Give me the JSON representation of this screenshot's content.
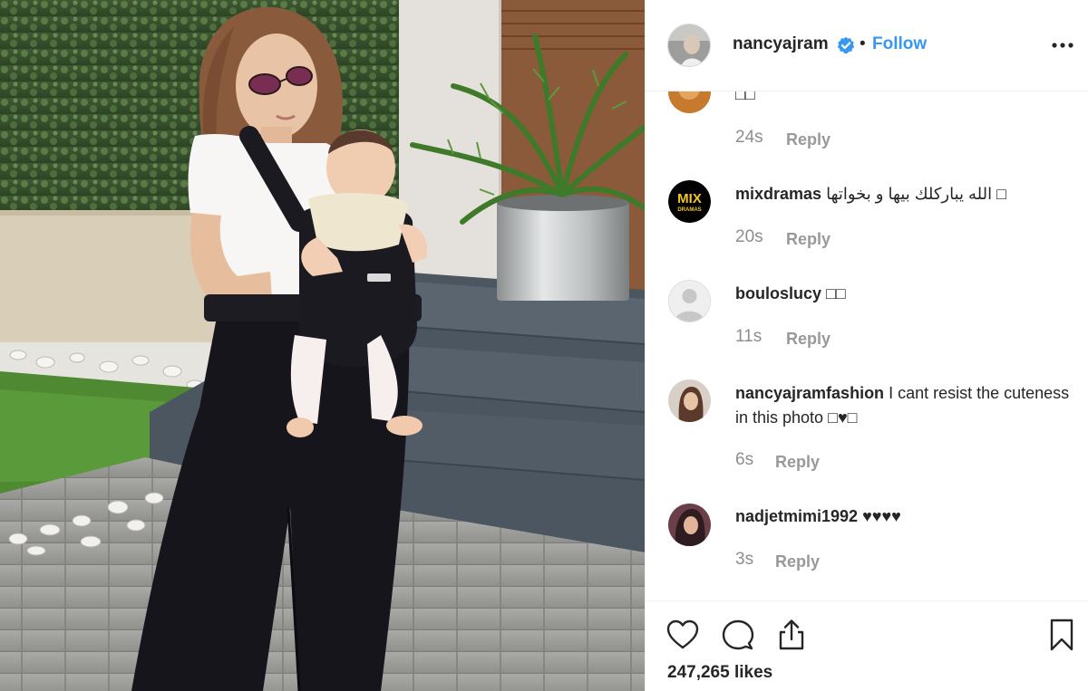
{
  "post": {
    "username": "nancyajram",
    "separator": "•",
    "follow_label": "Follow",
    "likes": "247,265 likes"
  },
  "comments": [
    {
      "username": "",
      "text": "□□",
      "time": "24s",
      "reply_label": "Reply"
    },
    {
      "username": "mixdramas",
      "text": "الله يباركلك بيها و بخواتها □",
      "time": "20s",
      "reply_label": "Reply"
    },
    {
      "username": "bouloslucy",
      "text": "□□",
      "time": "11s",
      "reply_label": "Reply"
    },
    {
      "username": "nancyajramfashion",
      "text": "I cant resist the cuteness in this photo □♥□",
      "time": "6s",
      "reply_label": "Reply"
    },
    {
      "username": "nadjetmimi1992",
      "text": "♥♥♥♥",
      "time": "3s",
      "reply_label": "Reply"
    }
  ],
  "avatar_logo_text": {
    "line1": "MIX",
    "line2": "DRAMAS"
  },
  "icons": {
    "verified": "verified-badge-icon",
    "more": "more-options-icon",
    "like": "heart-icon",
    "comment": "comment-bubble-icon",
    "share": "share-icon",
    "save": "bookmark-icon"
  },
  "colors": {
    "link_blue": "#3897f0",
    "verified_blue": "#3897f0",
    "meta_gray": "#8e8e8e",
    "text": "#262626"
  }
}
